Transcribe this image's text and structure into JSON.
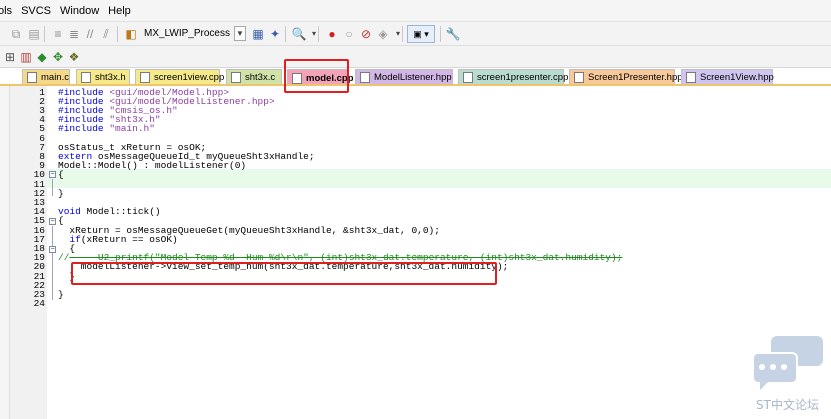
{
  "menubar": {
    "items": [
      "ols",
      "SVCS",
      "Window",
      "Help"
    ]
  },
  "toolbar": {
    "target_select": "MX_LWIP_Process",
    "icons": [
      "copy-icon",
      "paste-icon",
      "indent-icon",
      "unindent-icon",
      "comment-icon",
      "uncomment-icon",
      "target-options-icon",
      "dropdown-arrow-icon",
      "file-config-icon",
      "manage-icon",
      "zoom-icon",
      "breakpoint-icon",
      "disable-bp-icon",
      "clear-bp-icon",
      "kill-bp-icon",
      "view-icon",
      "wrench-icon"
    ]
  },
  "toolbar2": {
    "icons": [
      "project-icon",
      "books-icon",
      "green-diamond-icon",
      "green-arrows-icon",
      "gear-package-icon"
    ]
  },
  "tabs": [
    {
      "label": "main.c",
      "color": "#f6d88a",
      "active": false
    },
    {
      "label": "sht3x.h",
      "color": "#f6e98a",
      "active": false
    },
    {
      "label": "screen1view.cpp",
      "color": "#f6e98a",
      "active": false
    },
    {
      "label": "sht3x.c",
      "color": "#cfe3a9",
      "active": false
    },
    {
      "label": "model.cpp",
      "color": "#f3a3b8",
      "active": true
    },
    {
      "label": "ModelListener.hpp",
      "color": "#d2b6e6",
      "active": false
    },
    {
      "label": "screen1presenter.cpp",
      "color": "#b9dccf",
      "active": false
    },
    {
      "label": "Screen1Presenter.hpp",
      "color": "#f7c89a",
      "active": false
    },
    {
      "label": "Screen1View.hpp",
      "color": "#cfc5ee",
      "active": false
    }
  ],
  "editor": {
    "line_numbers": [
      "1",
      "2",
      "3",
      "4",
      "5",
      "6",
      "7",
      "8",
      "9",
      "10",
      "11",
      "12",
      "13",
      "14",
      "15",
      "16",
      "17",
      "18",
      "19",
      "20",
      "21",
      "22",
      "23",
      "24"
    ],
    "lines": [
      {
        "parts": [
          {
            "t": "#include ",
            "c": "kw"
          },
          {
            "t": "<gui/model/Model.hpp>",
            "c": "str"
          }
        ]
      },
      {
        "parts": [
          {
            "t": "#include ",
            "c": "kw"
          },
          {
            "t": "<gui/model/ModelListener.hpp>",
            "c": "str"
          }
        ]
      },
      {
        "parts": [
          {
            "t": "#include ",
            "c": "kw"
          },
          {
            "t": "\"cmsis_os.h\"",
            "c": "str"
          }
        ]
      },
      {
        "parts": [
          {
            "t": "#include ",
            "c": "kw"
          },
          {
            "t": "\"sht3x.h\"",
            "c": "str"
          }
        ]
      },
      {
        "parts": [
          {
            "t": "#include ",
            "c": "kw"
          },
          {
            "t": "\"main.h\"",
            "c": "str"
          }
        ]
      },
      {
        "parts": []
      },
      {
        "parts": [
          {
            "t": "osStatus_t xReturn = osOK;",
            "c": ""
          }
        ]
      },
      {
        "parts": [
          {
            "t": "extern",
            "c": "kw"
          },
          {
            "t": " osMessageQueueId_t myQueueSht3xHandle;",
            "c": ""
          }
        ]
      },
      {
        "parts": [
          {
            "t": "Model::Model() : modelListener(0)",
            "c": ""
          }
        ]
      },
      {
        "parts": [
          {
            "t": "{",
            "c": ""
          }
        ]
      },
      {
        "parts": []
      },
      {
        "parts": [
          {
            "t": "}",
            "c": ""
          }
        ]
      },
      {
        "parts": []
      },
      {
        "parts": [
          {
            "t": "void",
            "c": "kw"
          },
          {
            "t": " Model::tick()",
            "c": ""
          }
        ]
      },
      {
        "parts": [
          {
            "t": "{",
            "c": ""
          }
        ]
      },
      {
        "parts": [
          {
            "t": "  xReturn = osMessageQueueGet(myQueueSht3xHandle, &sht3x_dat, 0,0);",
            "c": ""
          }
        ]
      },
      {
        "parts": [
          {
            "t": "  ",
            "c": ""
          },
          {
            "t": "if",
            "c": "kw"
          },
          {
            "t": "(xReturn == osOK)",
            "c": ""
          }
        ]
      },
      {
        "parts": [
          {
            "t": "  {",
            "c": ""
          }
        ]
      },
      {
        "parts": [
          {
            "t": "//",
            "c": "cm"
          },
          {
            "t": "     U2_printf(\"Model Temp %d  Hum %d\\r\\n\", (int)sht3x_dat.temperature, (int)sht3x_dat.humidity);",
            "c": "cm struck"
          }
        ]
      },
      {
        "parts": [
          {
            "t": "    modelListener->view_set_temp_hum(sht3x_dat.temperature,sht3x_dat.humidity);",
            "c": ""
          }
        ]
      },
      {
        "parts": [
          {
            "t": "  }",
            "c": ""
          }
        ]
      },
      {
        "parts": []
      },
      {
        "parts": [
          {
            "t": "}",
            "c": ""
          }
        ]
      },
      {
        "parts": []
      }
    ]
  },
  "watermark": {
    "text": "ST中文论坛"
  }
}
